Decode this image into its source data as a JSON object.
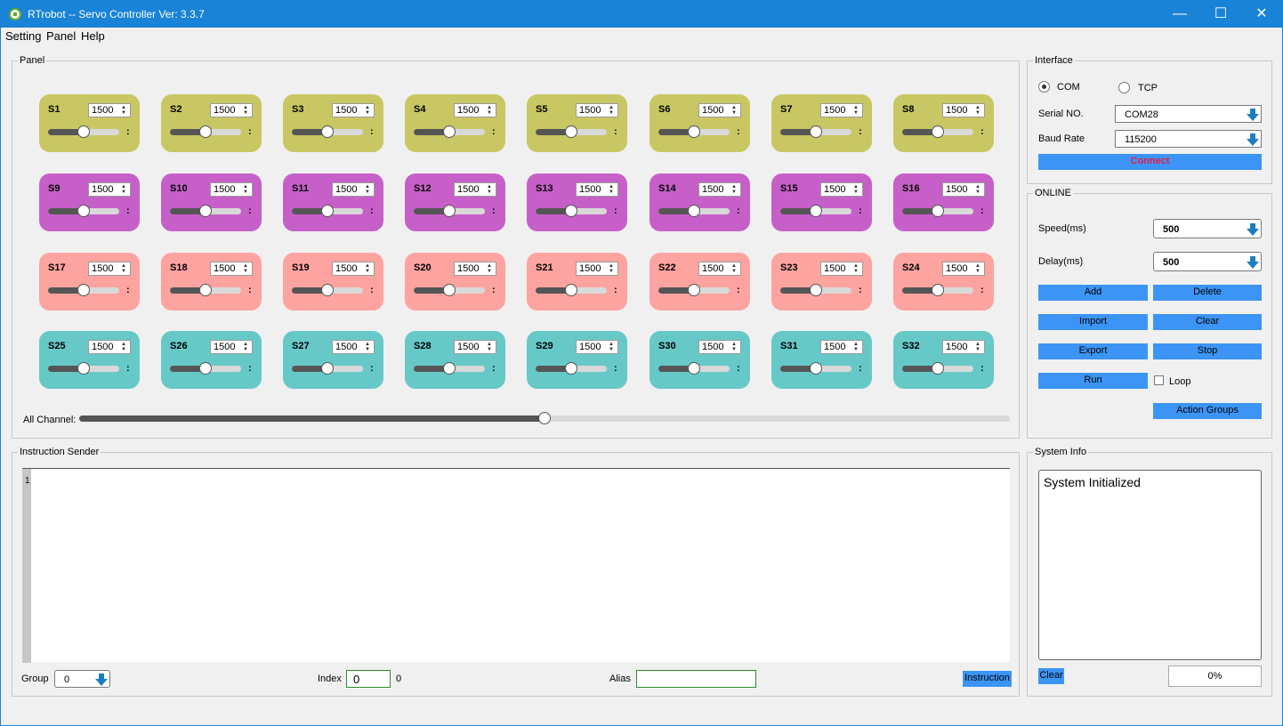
{
  "window": {
    "title": "RTrobot -- Servo Controller  Ver: 3.3.7",
    "minimize": "—",
    "maximize": "☐",
    "close": "✕"
  },
  "menu": [
    "Setting",
    "Panel",
    "Help"
  ],
  "panel": {
    "title": "Panel",
    "servos": [
      {
        "label": "S1",
        "value": "1500"
      },
      {
        "label": "S2",
        "value": "1500"
      },
      {
        "label": "S3",
        "value": "1500"
      },
      {
        "label": "S4",
        "value": "1500"
      },
      {
        "label": "S5",
        "value": "1500"
      },
      {
        "label": "S6",
        "value": "1500"
      },
      {
        "label": "S7",
        "value": "1500"
      },
      {
        "label": "S8",
        "value": "1500"
      },
      {
        "label": "S9",
        "value": "1500"
      },
      {
        "label": "S10",
        "value": "1500"
      },
      {
        "label": "S11",
        "value": "1500"
      },
      {
        "label": "S12",
        "value": "1500"
      },
      {
        "label": "S13",
        "value": "1500"
      },
      {
        "label": "S14",
        "value": "1500"
      },
      {
        "label": "S15",
        "value": "1500"
      },
      {
        "label": "S16",
        "value": "1500"
      },
      {
        "label": "S17",
        "value": "1500"
      },
      {
        "label": "S18",
        "value": "1500"
      },
      {
        "label": "S19",
        "value": "1500"
      },
      {
        "label": "S20",
        "value": "1500"
      },
      {
        "label": "S21",
        "value": "1500"
      },
      {
        "label": "S22",
        "value": "1500"
      },
      {
        "label": "S23",
        "value": "1500"
      },
      {
        "label": "S24",
        "value": "1500"
      },
      {
        "label": "S25",
        "value": "1500"
      },
      {
        "label": "S26",
        "value": "1500"
      },
      {
        "label": "S27",
        "value": "1500"
      },
      {
        "label": "S28",
        "value": "1500"
      },
      {
        "label": "S29",
        "value": "1500"
      },
      {
        "label": "S30",
        "value": "1500"
      },
      {
        "label": "S31",
        "value": "1500"
      },
      {
        "label": "S32",
        "value": "1500"
      }
    ],
    "servo_slider_fraction": 0.5,
    "colon": ":",
    "row_colors": [
      "#c9c764",
      "#c660c8",
      "#fda3a0",
      "#66c9c8"
    ],
    "all_channel_label": "All Channel:",
    "all_channel_fraction": 0.5
  },
  "interface": {
    "title": "Interface",
    "com_label": "COM",
    "tcp_label": "TCP",
    "serial_label": "Serial NO.",
    "serial_value": "COM28",
    "baud_label": "Baud Rate",
    "baud_value": "115200",
    "connect_label": "Connect",
    "connect_color": "#e8194a"
  },
  "online": {
    "title": "ONLINE",
    "speed_label": "Speed(ms)",
    "speed_value": "500",
    "delay_label": "Delay(ms)",
    "delay_value": "500",
    "add": "Add",
    "delete": "Delete",
    "import": "Import",
    "clear": "Clear",
    "export": "Export",
    "stop": "Stop",
    "run": "Run",
    "loop": "Loop",
    "action_groups": "Action Groups"
  },
  "instruction": {
    "title": "Instruction Sender",
    "line_number": "1",
    "group_label": "Group",
    "group_value": "0",
    "index_label": "Index",
    "index_value": "0",
    "index_count": "0",
    "alias_label": "Alias",
    "alias_value": "",
    "instruction_button": "Instruction"
  },
  "system_info": {
    "title": "System Info",
    "message": "System Initialized",
    "clear": "Clear",
    "progress": "0%"
  }
}
